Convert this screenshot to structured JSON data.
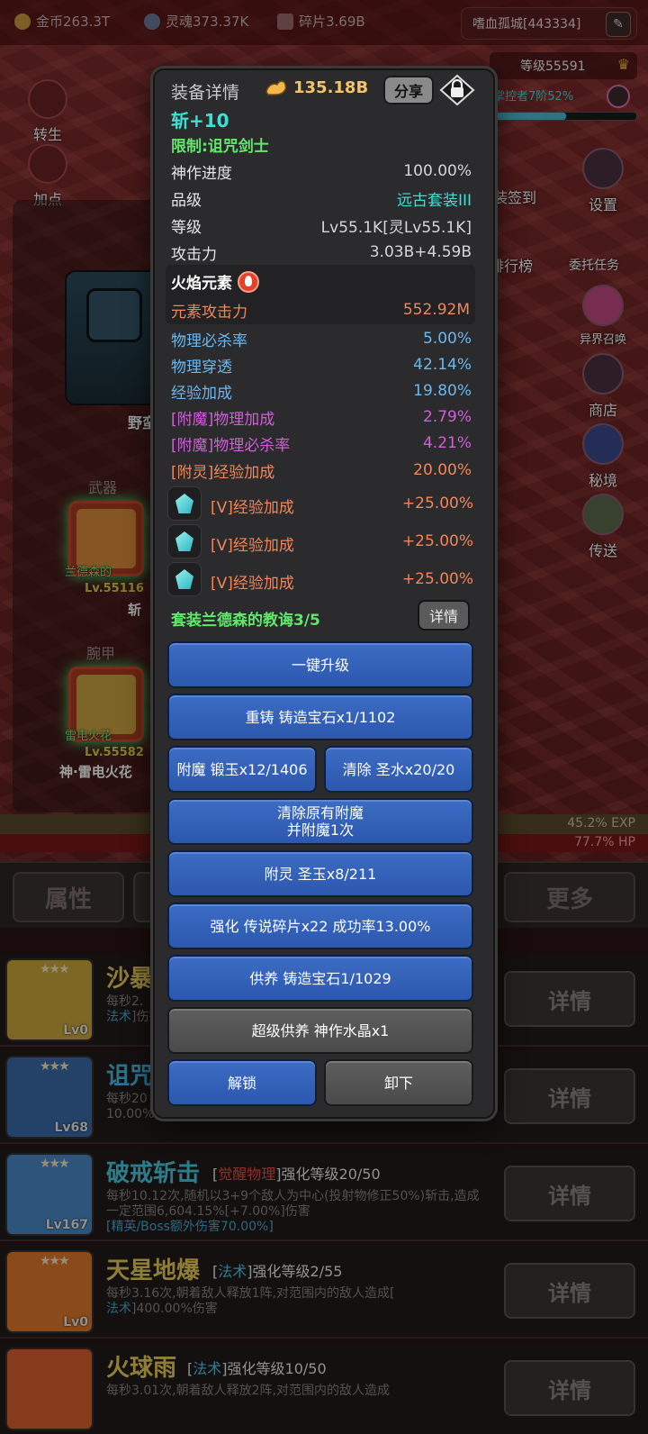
{
  "resources": {
    "gold": "金币263.3T",
    "soul": "灵魂373.37K",
    "shards": "碎片3.69B"
  },
  "guild": {
    "name": "嗜血孤城[443334]",
    "level": "等级55591",
    "master": "掌控者7阶52%",
    "master_progress": 0.52
  },
  "left_menu": {
    "rebirth": "转生",
    "add_points": "加点"
  },
  "right_menu": {
    "checkin": "装签到",
    "settings": "设置",
    "ranking": "排行榜",
    "delegate": "委托任务",
    "summon": "异界召唤",
    "shop": "商店",
    "secret": "秘境",
    "teleport": "传送"
  },
  "equipment_panel": {
    "weapon_title": "武器",
    "weapon_name": "兰德森的",
    "weapon_lv": "Lv.55116",
    "weapon_sub": "斩",
    "bracer_title": "腕甲",
    "bracer_name": "雷电火花",
    "bracer_lv": "Lv.55582",
    "bracer_sub": "神·雷电火花",
    "char_label": "野蛮"
  },
  "bars": {
    "exp": "45.2% EXP",
    "hp": "77.7% HP"
  },
  "tabs": {
    "attributes": "属性",
    "more": "更多"
  },
  "modal": {
    "header": "装备详情",
    "power": "135.18B",
    "share": "分享",
    "title": "斩+10",
    "limit": "限制:诅咒剑士",
    "rows": [
      {
        "k": "神作进度",
        "v": "100.00%"
      },
      {
        "k": "品级",
        "v": "远古套装III"
      },
      {
        "k": "等级",
        "v": "Lv55.1K[灵Lv55.1K]"
      },
      {
        "k": "攻击力",
        "v": "3.03B+4.59B"
      }
    ],
    "element_title": "火焰元素",
    "element_attack_k": "元素攻击力",
    "element_attack_v": "552.92M",
    "stats": [
      {
        "k": "物理必杀率",
        "v": "5.00%"
      },
      {
        "k": "物理穿透",
        "v": "42.14%"
      },
      {
        "k": "经验加成",
        "v": "19.80%"
      },
      {
        "k": "[附魔]物理加成",
        "v": "2.79%"
      },
      {
        "k": "[附魔]物理必杀率",
        "v": "4.21%"
      },
      {
        "k": "[附灵]经验加成",
        "v": "20.00%"
      }
    ],
    "gems": [
      {
        "k": "[V]经验加成",
        "v": "+25.00%"
      },
      {
        "k": "[V]经验加成",
        "v": "+25.00%"
      },
      {
        "k": "[V]经验加成",
        "v": "+25.00%"
      }
    ],
    "set_line": "套装兰德森的教诲3/5",
    "set_detail": "详情",
    "buttons": {
      "one_key": "一键升级",
      "recast": "重铸 铸造宝石x1/1102",
      "enchant": "附魔 锻玉x12/1406",
      "clear": "清除 圣水x20/20",
      "clear_enchant_1": "清除原有附魔",
      "clear_enchant_2": "并附魔1次",
      "spirit": "附灵 圣玉x8/211",
      "strengthen": "强化 传说碎片x22 成功率13.00%",
      "offer": "供养 铸造宝石1/1029",
      "super_offer": "超级供养 神作水晶x1",
      "unlock": "解锁",
      "unequip": "卸下"
    }
  },
  "skills": [
    {
      "name": "沙暴",
      "lv": "Lv0",
      "desc": "每秒2.",
      "tag": "法术",
      "desc2": "]伤害",
      "btn": "详情"
    },
    {
      "name": "诅咒",
      "lv": "Lv68",
      "desc": "每秒20",
      "desc2": "10.00%)伤害",
      "btn": "详情"
    },
    {
      "name": "破戒斩击",
      "lv": "Lv167",
      "meta_tag": "觉醒物理",
      "meta": "强化等级20/50",
      "desc": "每秒10.12次,随机以3+9个敌人为中心(投射物修正50%)斩击,造成一定范围6,604.15%[+7.00%]伤害",
      "desc2": "[精英/Boss额外伤害70.00%]",
      "btn": "详情"
    },
    {
      "name": "天星地爆",
      "lv": "Lv0",
      "meta_tag": "法术",
      "meta": "强化等级2/55",
      "desc": "每秒3.16次,朝着敌人释放1阵,对范围内的敌人造成[",
      "tag": "法术",
      "desc2": "]400.00%伤害",
      "btn": "详情"
    },
    {
      "name": "火球雨",
      "lv": "",
      "meta_tag": "法术",
      "meta": "强化等级10/50",
      "desc": "每秒3.01次,朝着敌人释放2阵,对范围内的敌人造成",
      "btn": "详情"
    }
  ],
  "colors": {
    "accent_blue": "#2c58ae",
    "title_cyan": "#3ee0d6",
    "limit_green": "#5fe86a",
    "enchant_pink": "#d05fd8",
    "spirit_orange": "#f0865a",
    "stat_blue": "#6ab8f0",
    "power_gold": "#f4c36a"
  }
}
